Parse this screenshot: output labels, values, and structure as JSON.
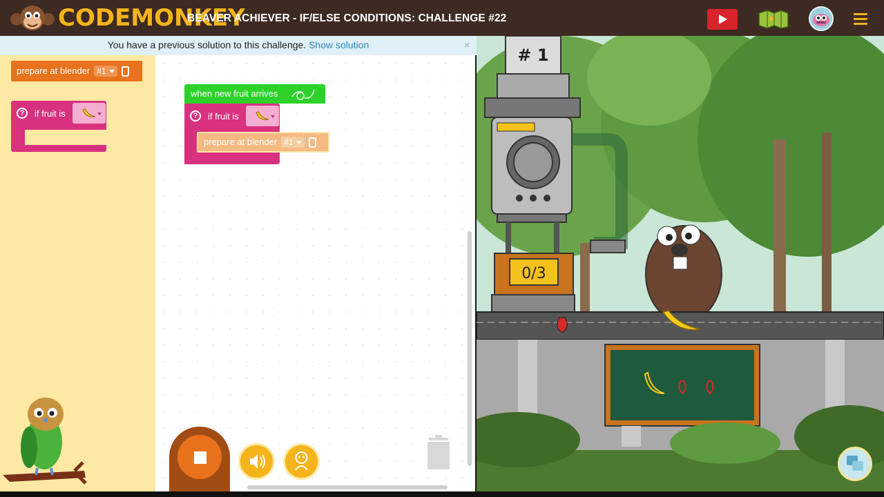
{
  "header": {
    "brand": "CODEMONKEY",
    "title": "BEAVER ACHIEVER - IF/ELSE CONDITIONS: CHALLENGE #22"
  },
  "notice": {
    "text": "You have a previous solution to this challenge.",
    "link": "Show solution",
    "close": "×"
  },
  "toolbox": {
    "prepare_block": {
      "label": "prepare at blender",
      "value": "#1"
    },
    "if_block": {
      "label": "if fruit is",
      "value": "banana"
    }
  },
  "workspace": {
    "event_block": {
      "label": "when new fruit arrives"
    },
    "if_block": {
      "label": "if fruit is",
      "value": "banana"
    },
    "prepare_block": {
      "label": "prepare at blender",
      "value": "#1"
    }
  },
  "game": {
    "machine_number": "# 1",
    "counter": "0/3",
    "board_fruits": [
      "banana",
      "strawberry",
      "strawberry"
    ]
  },
  "colors": {
    "header_bg": "#3d2a22",
    "brand": "#f4b41a",
    "toolbox_bg": "#fde8a4",
    "if_block": "#d8317f",
    "action_block": "#e8731c",
    "event_block": "#2ed12a",
    "link": "#2a8ab5",
    "play_button": "#d8232a"
  },
  "icons": {
    "play": "play-icon",
    "map": "map-icon",
    "avatar": "avatar-icon",
    "menu": "hamburger-menu-icon",
    "stop": "stop-icon",
    "sound": "speaker-icon",
    "robot": "robot-icon",
    "trash": "trash-icon",
    "hint": "hint-icon"
  }
}
